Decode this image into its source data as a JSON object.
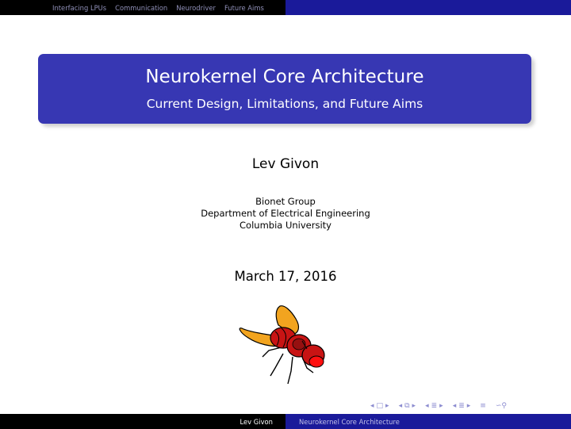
{
  "nav": {
    "sections": [
      "Interfacing LPUs",
      "Communication",
      "Neurodriver",
      "Future Aims"
    ]
  },
  "title": {
    "main": "Neurokernel Core Architecture",
    "subtitle": "Current Design, Limitations, and Future Aims"
  },
  "author": "Lev Givon",
  "institute": {
    "line1": "Bionet Group",
    "line2": "Department of Electrical Engineering",
    "line3": "Columbia University"
  },
  "date": "March 17, 2016",
  "footer": {
    "author": "Lev Givon",
    "title": "Neurokernel Core Architecture"
  },
  "nav_symbols": [
    "slide-nav-icon",
    "frame-nav-icon",
    "subsection-nav-icon",
    "section-nav-icon",
    "align-icon",
    "search-icon"
  ],
  "colors": {
    "title_box": "#3737b3",
    "header_right": "#1a1a9a",
    "header_left": "#000000"
  }
}
